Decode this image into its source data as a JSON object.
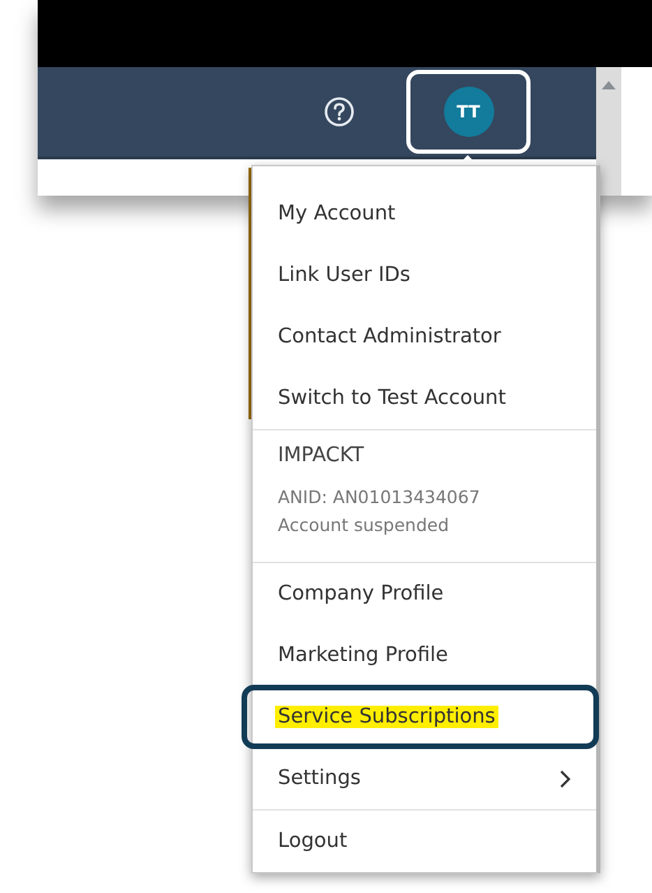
{
  "header": {
    "avatar": {
      "initials": "TT",
      "outlined": true
    }
  },
  "menu": {
    "groups": [
      {
        "kind": "links",
        "items": [
          {
            "label": "My Account",
            "highlighted": false,
            "submenu": false
          },
          {
            "label": "Link User IDs",
            "highlighted": false,
            "submenu": false
          },
          {
            "label": "Contact Administrator",
            "highlighted": false,
            "submenu": false
          },
          {
            "label": "Switch to Test Account",
            "highlighted": false,
            "submenu": false
          }
        ]
      },
      {
        "kind": "account",
        "name": "IMPACKT",
        "anid": "ANID: AN01013434067",
        "status": "Account suspended"
      },
      {
        "kind": "links",
        "items": [
          {
            "label": "Company Profile",
            "highlighted": false,
            "submenu": false
          },
          {
            "label": "Marketing Profile",
            "highlighted": false,
            "submenu": false
          },
          {
            "label": "Service Subscriptions",
            "highlighted": true,
            "submenu": false
          },
          {
            "label": "Settings",
            "highlighted": false,
            "submenu": true
          }
        ]
      },
      {
        "kind": "links",
        "items": [
          {
            "label": "Logout",
            "highlighted": false,
            "submenu": false
          }
        ]
      }
    ]
  }
}
